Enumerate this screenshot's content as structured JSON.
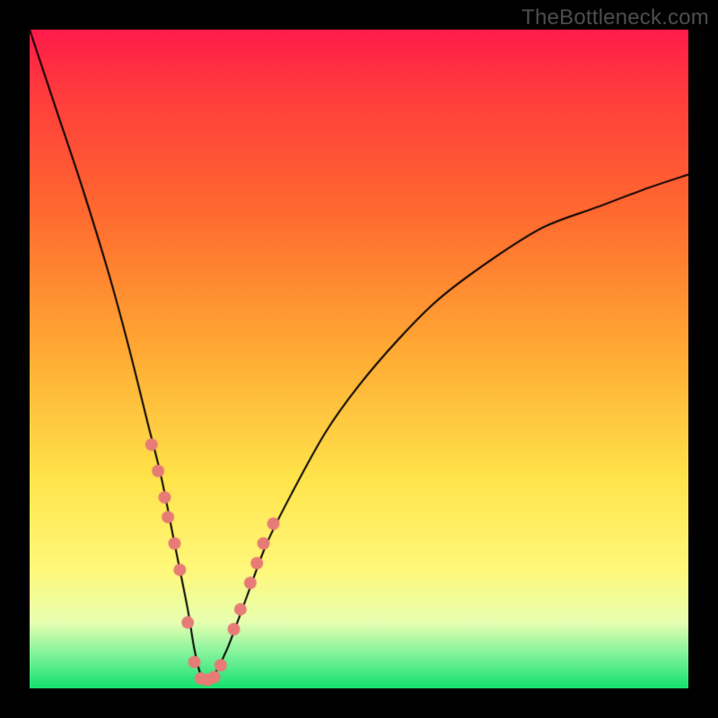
{
  "watermark": "TheBottleneck.com",
  "chart_data": {
    "type": "line",
    "title": "",
    "xlabel": "",
    "ylabel": "",
    "xlim": [
      0,
      100
    ],
    "ylim": [
      0,
      100
    ],
    "grid": false,
    "legend": false,
    "background_gradient": [
      "#ff1a4a",
      "#ffe34a",
      "#13e06d"
    ],
    "series": [
      {
        "name": "bottleneck-curve",
        "color": "#000000",
        "stroke_width": 2,
        "x": [
          0,
          4,
          8,
          12,
          15,
          18,
          20,
          22,
          24,
          25,
          26,
          27,
          28,
          30,
          33,
          36,
          40,
          45,
          50,
          56,
          62,
          70,
          78,
          86,
          94,
          100
        ],
        "values": [
          100,
          88,
          76,
          63,
          52,
          40,
          32,
          22,
          12,
          6,
          2,
          1,
          2,
          6,
          14,
          22,
          30,
          39,
          46,
          53,
          59,
          65,
          70,
          73,
          76,
          78
        ]
      },
      {
        "name": "sample-markers",
        "color": "#e77b76",
        "marker_radius": 7,
        "x": [
          18.5,
          19.5,
          20.5,
          21.0,
          22.0,
          22.8,
          24.0,
          25.0,
          26.0,
          27.0,
          28.0,
          29.0,
          31.0,
          32.0,
          33.5,
          34.5,
          35.5,
          37.0
        ],
        "values": [
          37.0,
          33.0,
          29.0,
          26.0,
          22.0,
          18.0,
          10.0,
          4.0,
          1.5,
          1.3,
          1.7,
          3.5,
          9.0,
          12.0,
          16.0,
          19.0,
          22.0,
          25.0
        ]
      }
    ]
  }
}
